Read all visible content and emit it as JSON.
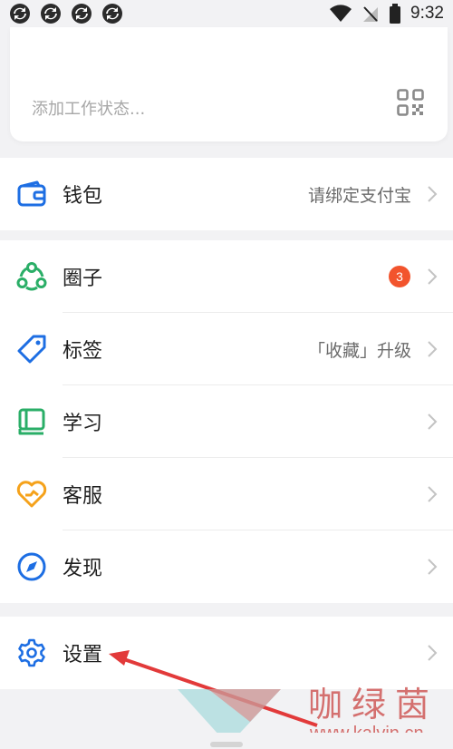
{
  "status_bar": {
    "time": "9:32",
    "notification_icons": [
      "sync-icon",
      "sync-icon",
      "sync-icon",
      "sync-icon"
    ]
  },
  "status_card": {
    "placeholder": "添加工作状态...",
    "qr_icon": "qr-code-icon"
  },
  "wallet": {
    "label": "钱包",
    "value": "请绑定支付宝",
    "icon": "wallet-icon"
  },
  "menu": [
    {
      "key": "circle",
      "label": "圈子",
      "badge": "3",
      "icon": "circle-group-icon"
    },
    {
      "key": "tags",
      "label": "标签",
      "value": "「收藏」升级",
      "icon": "tag-icon"
    },
    {
      "key": "study",
      "label": "学习",
      "icon": "book-icon"
    },
    {
      "key": "service",
      "label": "客服",
      "icon": "heart-service-icon"
    },
    {
      "key": "discover",
      "label": "发现",
      "icon": "compass-icon"
    }
  ],
  "settings": {
    "label": "设置",
    "icon": "gear-icon"
  },
  "colors": {
    "blue": "#1d6ee3",
    "green": "#2aae67",
    "orange": "#f5a21b",
    "badge_red": "#f2542d"
  },
  "watermark": {
    "text_cn": "咖绿茵",
    "url": "www.kalvin.cn"
  }
}
